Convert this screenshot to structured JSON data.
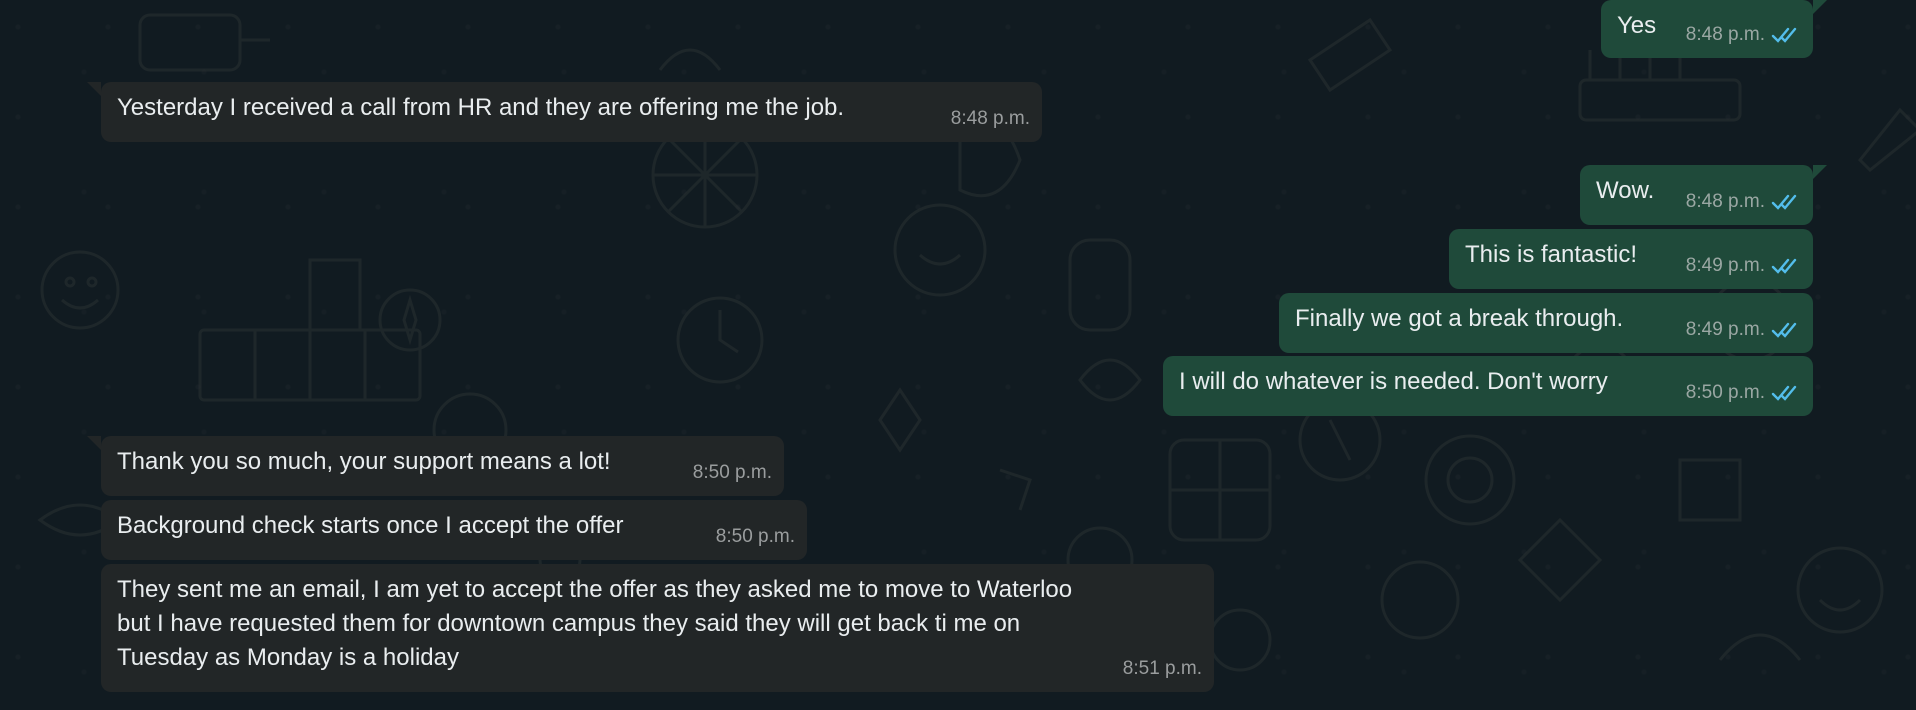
{
  "app": "WhatsApp",
  "colors": {
    "incoming_bubble": "#222627",
    "outgoing_bubble": "#1f4a3a",
    "read_receipt": "#53bdeb",
    "timestamp": "#9aa7a3",
    "text": "#e9edef"
  },
  "messages": [
    {
      "direction": "outgoing",
      "text": "Yes",
      "time": "8:48 p.m.",
      "status_icon": "double-check-read-icon"
    },
    {
      "direction": "incoming",
      "text": "Yesterday I received a call from HR and they are offering me the job.",
      "time": "8:48 p.m."
    },
    {
      "direction": "outgoing",
      "text": "Wow.",
      "time": "8:48 p.m.",
      "status_icon": "double-check-read-icon"
    },
    {
      "direction": "outgoing",
      "text": "This is fantastic!",
      "time": "8:49 p.m.",
      "status_icon": "double-check-read-icon"
    },
    {
      "direction": "outgoing",
      "text": "Finally we got a break through.",
      "time": "8:49 p.m.",
      "status_icon": "double-check-read-icon"
    },
    {
      "direction": "outgoing",
      "text": "I will do whatever is needed. Don't worry",
      "time": "8:50 p.m.",
      "status_icon": "double-check-read-icon"
    },
    {
      "direction": "incoming",
      "text": "Thank you so much, your support means a lot!",
      "time": "8:50 p.m."
    },
    {
      "direction": "incoming",
      "text": "Background check starts once I accept the offer",
      "time": "8:50 p.m."
    },
    {
      "direction": "incoming",
      "text": "They sent me an email, I am yet to accept the offer as they asked me to move to Waterloo\nbut I have requested them for downtown campus they said they will get back ti me on\nTuesday as Monday is a holiday",
      "time": "8:51 p.m."
    }
  ]
}
